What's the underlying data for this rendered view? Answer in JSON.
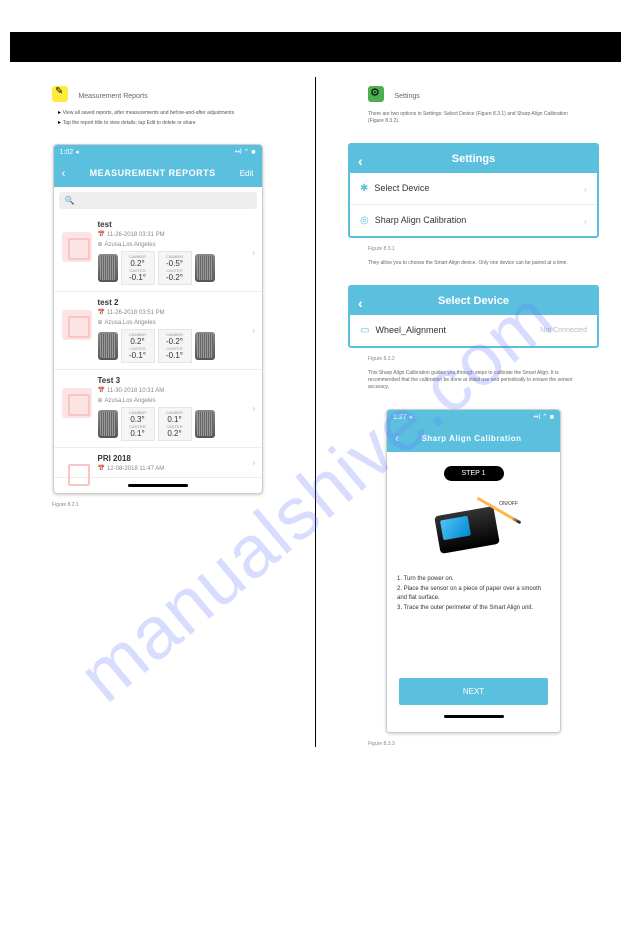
{
  "watermark": "manualshive.com",
  "left": {
    "section": "Measurement Reports",
    "bullets": [
      "View all saved reports, after measurements and before-and-after adjustments",
      "Tap the report title to view details; tap Edit to delete or share"
    ],
    "fig": "Figure 8.2.1",
    "phone": {
      "time": "1:02 ◂",
      "status_icons": "••l ⌃ ■",
      "header": "MEASUREMENT REPORTS",
      "edit": "Edit",
      "search": "🔍",
      "reports": [
        {
          "title": "test",
          "date": "11-26-2018 03:31 PM",
          "loc": "Azusa,Los Angeles",
          "camL": "0.2°",
          "casL": "-0.1°",
          "camR": "-0.5°",
          "casR": "-0.2°"
        },
        {
          "title": "test 2",
          "date": "11-26-2018 03:51 PM",
          "loc": "Azusa,Los Angeles",
          "camL": "0.2°",
          "casL": "-0.1°",
          "camR": "-0.2°",
          "casR": "-0.1°"
        },
        {
          "title": "Test 3",
          "date": "11-30-2018 10:31 AM",
          "loc": "Azusa,Los Angeles",
          "camL": "0.3°",
          "casL": "0.1°",
          "camR": "0.1°",
          "casR": "0.2°"
        },
        {
          "title": "PRI 2018",
          "date": "12-08-2018 11:47 AM",
          "loc": "",
          "camL": "",
          "casL": "",
          "camR": "",
          "casR": ""
        }
      ],
      "labels": {
        "camber": "CAMBER",
        "caster": "CASTER"
      }
    }
  },
  "right": {
    "section": "Settings",
    "desc1": "There are two options in Settings: Select Device (Figure 8.3.1) and Sharp Align Calibration (Figure 8.3.2).",
    "desc2": "They allow you to choose the Smart Align device. Only one device can be paired at a time.",
    "desc3": "This Sharp Align Calibration guides you through steps to calibrate the Smart Align. It is recommended that the calibration be done at initial use and periodically to ensure the sensor accuracy.",
    "fig1": "Figure 8.3.1",
    "fig2": "Figure 8.3.2",
    "fig3": "Figure 8.3.3",
    "settings": {
      "header": "Settings",
      "item1": "Select Device",
      "item2": "Sharp Align Calibration"
    },
    "select": {
      "header": "Select Device",
      "device": "Wheel_Alignment",
      "status": "Not Connected"
    },
    "calib": {
      "time": "1:27 ◂",
      "status_icons": "••l ⌃ ■",
      "header": "Sharp Align Calibration",
      "step": "STEP 1",
      "onoff": "ON/OFF",
      "line1": "1. Turn the power on.",
      "line2": "2. Place the sensor on a piece of paper over a smooth and flat surface.",
      "line3": "3. Trace the outer perimeter of the Smart Align unit.",
      "next": "NEXT"
    }
  }
}
